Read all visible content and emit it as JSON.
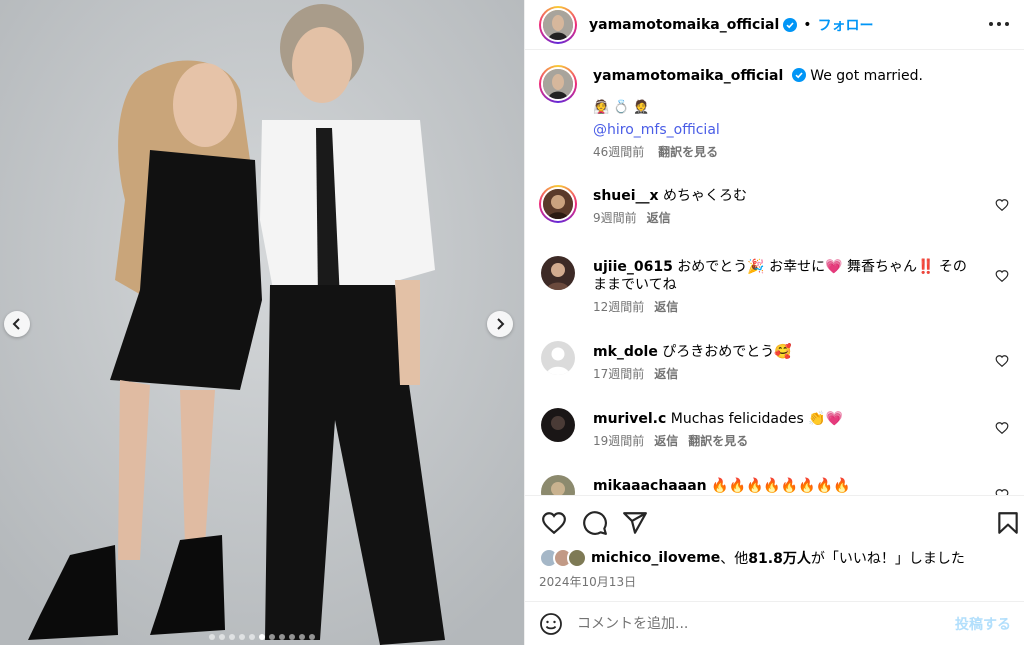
{
  "post": {
    "author": "yamamotomaika_official",
    "follow_label": "フォロー",
    "separator": "•",
    "caption": "We got married.",
    "caption_emojis": "👰💍🤵",
    "mention": "@hiro_mfs_official",
    "caption_time": "46週間前",
    "translate_label": "翻訳を見る"
  },
  "comments": [
    {
      "user": "shuei__x",
      "text": "めちゃくろむ",
      "time": "9週間前",
      "reply": "返信"
    },
    {
      "user": "ujiie_0615",
      "text": "おめでとう🎉 お幸せに💗 舞香ちゃん‼️ そのままでいてね",
      "time": "12週間前",
      "reply": "返信"
    },
    {
      "user": "mk_dole",
      "text": "ぴろきおめでとう🥰",
      "time": "17週間前",
      "reply": "返信"
    },
    {
      "user": "murivel.c",
      "text": "Muchas felicidades 👏💗",
      "time": "19週間前",
      "reply": "返信",
      "translate": "翻訳を見る"
    },
    {
      "user": "mikaaachaaan",
      "text": "🔥🔥🔥🔥🔥🔥🔥🔥"
    }
  ],
  "likes": {
    "user": "michico_iloveme",
    "text_1": "、他",
    "count": "81.8万人",
    "text_2": "が「いいね！」しました"
  },
  "date": "2024年10月13日",
  "comment_box": {
    "placeholder": "コメントを追加...",
    "post_label": "投稿する"
  },
  "carousel": {
    "total": 11,
    "active": 6
  },
  "colors": {
    "accent": "#0095f6",
    "verified": "#0095f6",
    "muted": "#737373",
    "post_disabled": "#b2dffc"
  }
}
